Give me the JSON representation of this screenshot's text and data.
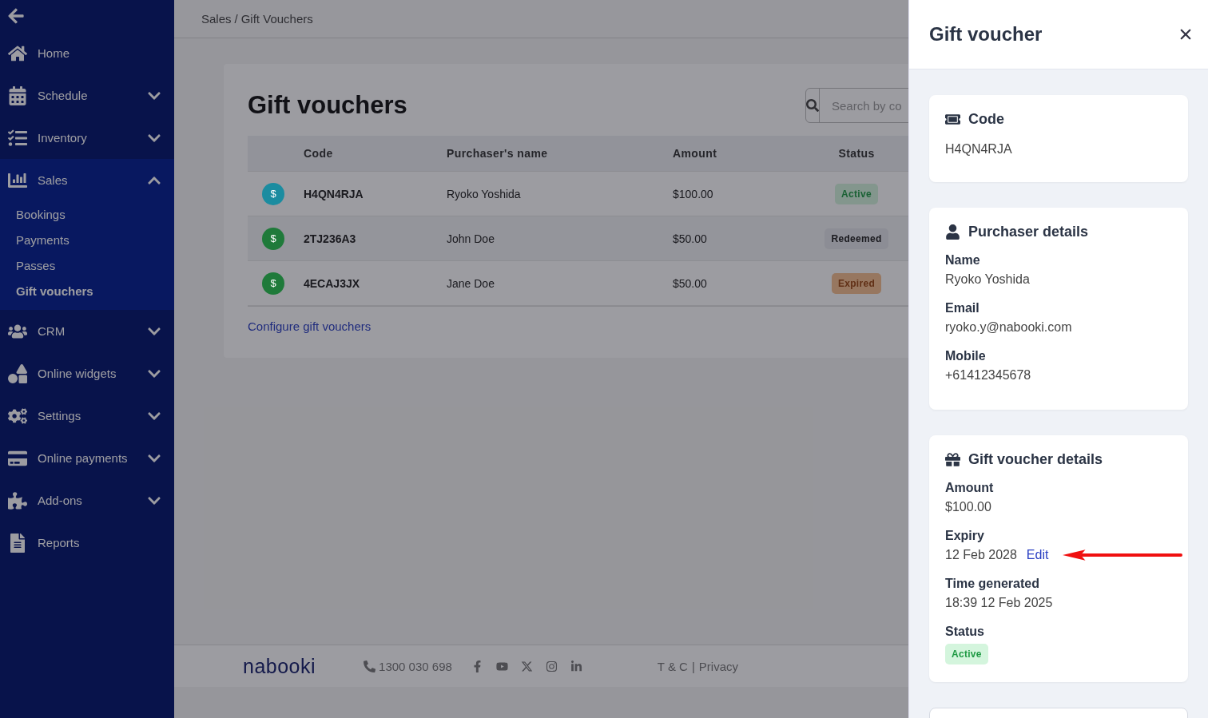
{
  "breadcrumb": {
    "items": [
      "Sales",
      "Gift Vouchers"
    ],
    "separator": "/"
  },
  "sidebar": {
    "items": [
      {
        "label": "Home"
      },
      {
        "label": "Schedule",
        "expanded": false
      },
      {
        "label": "Inventory",
        "expanded": false
      },
      {
        "label": "Sales",
        "expanded": true,
        "children": [
          {
            "label": "Bookings",
            "selected": false
          },
          {
            "label": "Payments",
            "selected": false
          },
          {
            "label": "Passes",
            "selected": false
          },
          {
            "label": "Gift vouchers",
            "selected": true
          }
        ]
      },
      {
        "label": "CRM",
        "expanded": false
      },
      {
        "label": "Online widgets",
        "expanded": false
      },
      {
        "label": "Settings",
        "expanded": false
      },
      {
        "label": "Online payments",
        "expanded": false
      },
      {
        "label": "Add-ons",
        "expanded": false
      },
      {
        "label": "Reports"
      }
    ]
  },
  "page": {
    "title": "Gift vouchers",
    "search": {
      "placeholder": "Search by co"
    },
    "table": {
      "columns": [
        "Code",
        "Purchaser's name",
        "Amount",
        "Status"
      ],
      "rows": [
        {
          "color": "#1b8ca0",
          "icon": "$",
          "code": "H4QN4RJA",
          "name": "Ryoko Yoshida",
          "amount": "$100.00",
          "status": {
            "label": "Active",
            "kind": "active"
          }
        },
        {
          "color": "#1f7a3a",
          "icon": "$",
          "code": "2TJ236A3",
          "name": "John Doe",
          "amount": "$50.00",
          "status": {
            "label": "Redeemed",
            "kind": "redeemed"
          }
        },
        {
          "color": "#1f7a3a",
          "icon": "$",
          "code": "4ECAJ3JX",
          "name": "Jane Doe",
          "amount": "$50.00",
          "status": {
            "label": "Expired",
            "kind": "expired"
          }
        }
      ]
    },
    "link": "Configure gift vouchers"
  },
  "footer": {
    "logo": "nabooki",
    "phone": "1300 030 698",
    "links": [
      "T & C",
      "Privacy"
    ],
    "separator": "|"
  },
  "drawer": {
    "title": "Gift voucher",
    "sections": [
      {
        "kind": "code",
        "title": "Code",
        "value": "H4QN4RJA"
      },
      {
        "kind": "purchaser",
        "title": "Purchaser details",
        "fields": [
          {
            "label": "Name",
            "value": "Ryoko Yoshida"
          },
          {
            "label": "Email",
            "value": "ryoko.y@nabooki.com"
          },
          {
            "label": "Mobile",
            "value": "+61412345678"
          }
        ]
      },
      {
        "kind": "details",
        "title": "Gift voucher details",
        "fields": [
          {
            "label": "Amount",
            "value": "$100.00"
          },
          {
            "label": "Expiry",
            "value": "12 Feb 2028",
            "action": "Edit",
            "annotation": {
              "kind": "arrow"
            }
          },
          {
            "label": "Time generated",
            "value": "18:39 12 Feb 2025"
          },
          {
            "label": "Status",
            "badge": {
              "label": "Active",
              "kind": "active"
            }
          }
        ]
      },
      {
        "kind": "partial"
      }
    ]
  }
}
